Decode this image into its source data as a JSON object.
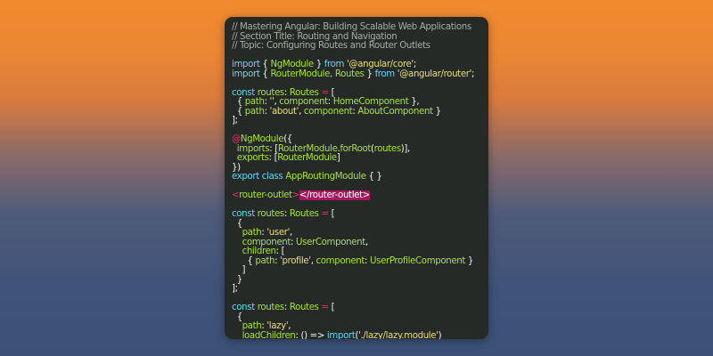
{
  "code_lines": [
    [
      {
        "t": "// Mastering Angular: Building Scalable Web Applications",
        "c": "comment"
      }
    ],
    [
      {
        "t": "// Section Title: Routing and Navigation",
        "c": "comment"
      }
    ],
    [
      {
        "t": "// Topic: Configuring Routes and Router Outlets",
        "c": "comment"
      }
    ],
    [],
    [
      {
        "t": "import",
        "c": "kw"
      },
      {
        "t": " { ",
        "c": "plain"
      },
      {
        "t": "NgModule",
        "c": "ident"
      },
      {
        "t": " } ",
        "c": "plain"
      },
      {
        "t": "from",
        "c": "kw"
      },
      {
        "t": " ",
        "c": "plain"
      },
      {
        "t": "'@angular/core'",
        "c": "str"
      },
      {
        "t": ";",
        "c": "plain"
      }
    ],
    [
      {
        "t": "import",
        "c": "kw"
      },
      {
        "t": " { ",
        "c": "plain"
      },
      {
        "t": "RouterModule, Routes",
        "c": "ident"
      },
      {
        "t": " } ",
        "c": "plain"
      },
      {
        "t": "from",
        "c": "kw"
      },
      {
        "t": " ",
        "c": "plain"
      },
      {
        "t": "'@angular/router'",
        "c": "str"
      },
      {
        "t": ";",
        "c": "plain"
      }
    ],
    [],
    [
      {
        "t": "const",
        "c": "kw"
      },
      {
        "t": " ",
        "c": "plain"
      },
      {
        "t": "routes",
        "c": "ident"
      },
      {
        "t": ": ",
        "c": "plain"
      },
      {
        "t": "Routes",
        "c": "ident"
      },
      {
        "t": " = ",
        "c": "pink"
      },
      {
        "t": "[",
        "c": "plain"
      }
    ],
    [
      {
        "t": "  { ",
        "c": "plain"
      },
      {
        "t": "path",
        "c": "ident"
      },
      {
        "t": ": ",
        "c": "plain"
      },
      {
        "t": "''",
        "c": "str"
      },
      {
        "t": ", ",
        "c": "plain"
      },
      {
        "t": "component",
        "c": "ident"
      },
      {
        "t": ": ",
        "c": "plain"
      },
      {
        "t": "HomeComponent",
        "c": "ident"
      },
      {
        "t": " },",
        "c": "plain"
      }
    ],
    [
      {
        "t": "  { ",
        "c": "plain"
      },
      {
        "t": "path",
        "c": "ident"
      },
      {
        "t": ": ",
        "c": "plain"
      },
      {
        "t": "'about'",
        "c": "str"
      },
      {
        "t": ", ",
        "c": "plain"
      },
      {
        "t": "component",
        "c": "ident"
      },
      {
        "t": ": ",
        "c": "plain"
      },
      {
        "t": "AboutComponent",
        "c": "ident"
      },
      {
        "t": " }",
        "c": "plain"
      }
    ],
    [
      {
        "t": "];",
        "c": "plain"
      }
    ],
    [],
    [
      {
        "t": "@",
        "c": "pink"
      },
      {
        "t": "NgModule",
        "c": "ident"
      },
      {
        "t": "({",
        "c": "plain"
      }
    ],
    [
      {
        "t": "  ",
        "c": "plain"
      },
      {
        "t": "imports",
        "c": "ident"
      },
      {
        "t": ": [",
        "c": "plain"
      },
      {
        "t": "RouterModule",
        "c": "ident"
      },
      {
        "t": ".",
        "c": "plain"
      },
      {
        "t": "forRoot",
        "c": "ident"
      },
      {
        "t": "(",
        "c": "plain"
      },
      {
        "t": "routes",
        "c": "ident"
      },
      {
        "t": ")],",
        "c": "plain"
      }
    ],
    [
      {
        "t": "  ",
        "c": "plain"
      },
      {
        "t": "exports",
        "c": "ident"
      },
      {
        "t": ": [",
        "c": "plain"
      },
      {
        "t": "RouterModule",
        "c": "ident"
      },
      {
        "t": "]",
        "c": "plain"
      }
    ],
    [
      {
        "t": "})",
        "c": "plain"
      }
    ],
    [
      {
        "t": "export",
        "c": "kw"
      },
      {
        "t": " ",
        "c": "plain"
      },
      {
        "t": "class",
        "c": "kw"
      },
      {
        "t": " ",
        "c": "plain"
      },
      {
        "t": "AppRoutingModule",
        "c": "ident"
      },
      {
        "t": " { }",
        "c": "plain"
      }
    ],
    [],
    [
      {
        "t": "<",
        "c": "pink"
      },
      {
        "t": "router-outlet",
        "c": "ident"
      },
      {
        "t": ">",
        "c": "pink"
      },
      {
        "t": "</router-outlet>",
        "c": "hl"
      }
    ],
    [],
    [
      {
        "t": "const",
        "c": "kw"
      },
      {
        "t": " ",
        "c": "plain"
      },
      {
        "t": "routes",
        "c": "ident"
      },
      {
        "t": ": ",
        "c": "plain"
      },
      {
        "t": "Routes",
        "c": "ident"
      },
      {
        "t": " = ",
        "c": "pink"
      },
      {
        "t": "[",
        "c": "plain"
      }
    ],
    [
      {
        "t": "  {",
        "c": "plain"
      }
    ],
    [
      {
        "t": "    ",
        "c": "plain"
      },
      {
        "t": "path",
        "c": "ident"
      },
      {
        "t": ": ",
        "c": "plain"
      },
      {
        "t": "'user'",
        "c": "str"
      },
      {
        "t": ",",
        "c": "plain"
      }
    ],
    [
      {
        "t": "    ",
        "c": "plain"
      },
      {
        "t": "component",
        "c": "ident"
      },
      {
        "t": ": ",
        "c": "plain"
      },
      {
        "t": "UserComponent",
        "c": "ident"
      },
      {
        "t": ",",
        "c": "plain"
      }
    ],
    [
      {
        "t": "    ",
        "c": "plain"
      },
      {
        "t": "children",
        "c": "ident"
      },
      {
        "t": ": [",
        "c": "plain"
      }
    ],
    [
      {
        "t": "      { ",
        "c": "plain"
      },
      {
        "t": "path",
        "c": "ident"
      },
      {
        "t": ": ",
        "c": "plain"
      },
      {
        "t": "'profile'",
        "c": "str"
      },
      {
        "t": ", ",
        "c": "plain"
      },
      {
        "t": "component",
        "c": "ident"
      },
      {
        "t": ": ",
        "c": "plain"
      },
      {
        "t": "UserProfileComponent",
        "c": "ident"
      },
      {
        "t": " }",
        "c": "plain"
      }
    ],
    [
      {
        "t": "    ]",
        "c": "plain"
      }
    ],
    [
      {
        "t": "  }",
        "c": "plain"
      }
    ],
    [
      {
        "t": "];",
        "c": "plain"
      }
    ],
    [],
    [
      {
        "t": "const",
        "c": "kw"
      },
      {
        "t": " ",
        "c": "plain"
      },
      {
        "t": "routes",
        "c": "ident"
      },
      {
        "t": ": ",
        "c": "plain"
      },
      {
        "t": "Routes",
        "c": "ident"
      },
      {
        "t": " = ",
        "c": "pink"
      },
      {
        "t": "[",
        "c": "plain"
      }
    ],
    [
      {
        "t": "  {",
        "c": "plain"
      }
    ],
    [
      {
        "t": "    ",
        "c": "plain"
      },
      {
        "t": "path",
        "c": "ident"
      },
      {
        "t": ": ",
        "c": "plain"
      },
      {
        "t": "'lazy'",
        "c": "str"
      },
      {
        "t": ",",
        "c": "plain"
      }
    ],
    [
      {
        "t": "    ",
        "c": "plain"
      },
      {
        "t": "loadChildren",
        "c": "ident"
      },
      {
        "t": ": () => ",
        "c": "plain"
      },
      {
        "t": "import",
        "c": "kw"
      },
      {
        "t": "(",
        "c": "plain"
      },
      {
        "t": "'./lazy/lazy.module'",
        "c": "str"
      },
      {
        "t": ")",
        "c": "plain"
      }
    ],
    [
      {
        "t": "  }",
        "c": "plain"
      }
    ],
    [
      {
        "t": "];",
        "c": "plain"
      }
    ]
  ],
  "colors": {
    "comment": "#a8aaa5",
    "keyword": "#68d3f0",
    "string": "#e9dd7b",
    "identifier": "#a7e23a",
    "operator": "#f2286e",
    "plain": "#f2f2ee",
    "highlight_bg": "#a3175e",
    "editor_bg": "#262a26"
  }
}
